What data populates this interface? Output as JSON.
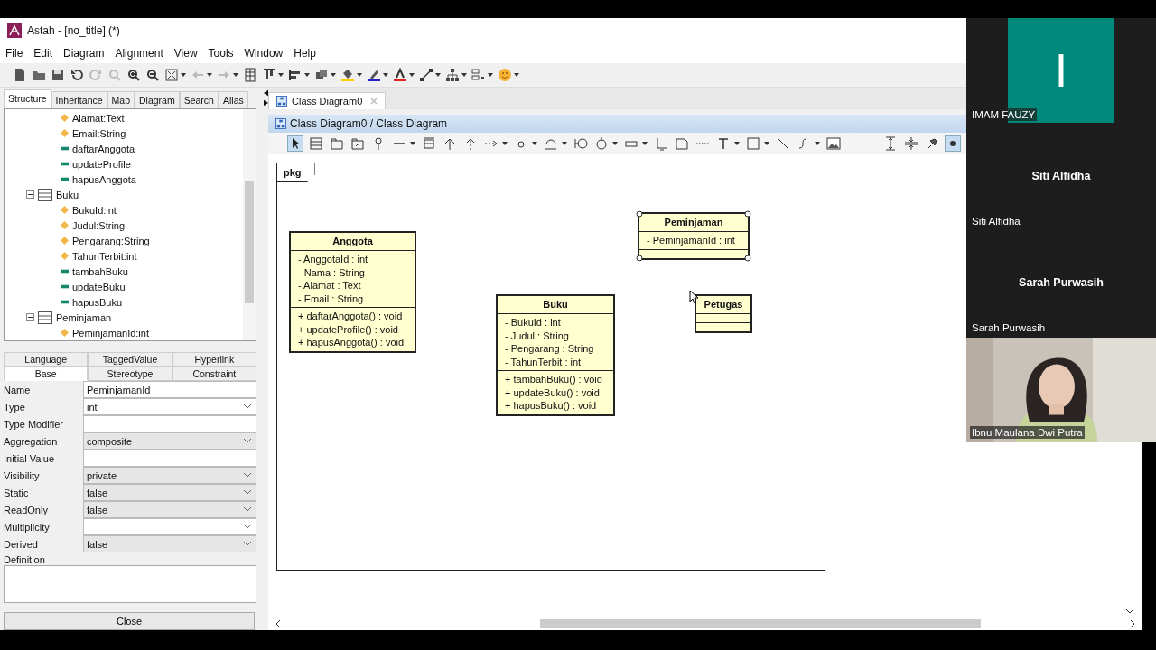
{
  "window": {
    "title": "Astah - [no_title] (*)"
  },
  "menu": [
    "File",
    "Edit",
    "Diagram",
    "Alignment",
    "View",
    "Tools",
    "Window",
    "Help"
  ],
  "left_tabs": [
    {
      "label": "Structure",
      "selected": true
    },
    {
      "label": "Inheritance",
      "selected": false
    },
    {
      "label": "Map",
      "selected": false
    },
    {
      "label": "Diagram",
      "selected": false
    },
    {
      "label": "Search",
      "selected": false
    },
    {
      "label": "Alias",
      "selected": false
    }
  ],
  "tree": [
    {
      "label": "Alamat:Text",
      "kind": "attribute"
    },
    {
      "label": "Email:String",
      "kind": "attribute"
    },
    {
      "label": "daftarAnggota",
      "kind": "operation"
    },
    {
      "label": "updateProfile",
      "kind": "operation"
    },
    {
      "label": "hapusAnggota",
      "kind": "operation"
    },
    {
      "label": "Buku",
      "kind": "class",
      "expanded": true,
      "children": [
        {
          "label": "BukuId:int",
          "kind": "attribute"
        },
        {
          "label": "Judul:String",
          "kind": "attribute"
        },
        {
          "label": "Pengarang:String",
          "kind": "attribute"
        },
        {
          "label": "TahunTerbit:int",
          "kind": "attribute"
        },
        {
          "label": "tambahBuku",
          "kind": "operation"
        },
        {
          "label": "updateBuku",
          "kind": "operation"
        },
        {
          "label": "hapusBuku",
          "kind": "operation"
        }
      ]
    },
    {
      "label": "Peminjaman",
      "kind": "class",
      "expanded": true,
      "children": [
        {
          "label": "PeminjamanId:int",
          "kind": "attribute"
        }
      ]
    }
  ],
  "property_tabs": {
    "back_row": [
      {
        "label": "Language",
        "selected": false
      },
      {
        "label": "TaggedValue",
        "selected": false
      },
      {
        "label": "Hyperlink",
        "selected": false
      }
    ],
    "front_row": [
      {
        "label": "Base",
        "selected": true
      },
      {
        "label": "Stereotype",
        "selected": false
      },
      {
        "label": "Constraint",
        "selected": false
      }
    ]
  },
  "properties": [
    {
      "label": "Name",
      "value": "PeminjamanId",
      "kind": "text"
    },
    {
      "label": "Type",
      "value": "int",
      "kind": "combo"
    },
    {
      "label": "Type Modifier",
      "kind": "text"
    },
    {
      "label": "Aggregation",
      "value": "composite",
      "kind": "select"
    },
    {
      "label": "Initial Value",
      "kind": "text"
    },
    {
      "label": "Visibility",
      "value": "private",
      "kind": "select"
    },
    {
      "label": "Static",
      "value": "false",
      "kind": "select"
    },
    {
      "label": "ReadOnly",
      "value": "false",
      "kind": "select"
    },
    {
      "label": "Multiplicity",
      "kind": "combo"
    },
    {
      "label": "Derived",
      "value": "false",
      "kind": "select"
    }
  ],
  "definition": {
    "label": "Definition"
  },
  "close_button": "Close",
  "document_tab": {
    "label": "Class Diagram0"
  },
  "diagram_title": "Class Diagram0 / Class Diagram",
  "frame_label": "pkg",
  "classes": [
    {
      "name": "Anggota",
      "selected": false,
      "attributes": [
        "- AnggotaId : int",
        "- Nama : String",
        "- Alamat : Text",
        "- Email : String"
      ],
      "operations": [
        "+ daftarAnggota() : void",
        "+ updateProfile() : void",
        "+ hapusAnggota() : void"
      ]
    },
    {
      "name": "Buku",
      "selected": false,
      "attributes": [
        "- BukuId : int",
        "- Judul : String",
        "- Pengarang : String",
        "- TahunTerbit : int"
      ],
      "operations": [
        "+ tambahBuku() : void",
        "+ updateBuku() : void",
        "+ hapusBuku() : void"
      ]
    },
    {
      "name": "Peminjaman",
      "selected": true,
      "attributes": [
        "- PeminjamanId : int"
      ]
    },
    {
      "name": "Petugas",
      "selected": false
    }
  ],
  "participants": [
    {
      "name": "IMAM FAUZY",
      "kind": "avatar",
      "initial": "I"
    },
    {
      "name": "Siti Alfidha",
      "kind": "name-only",
      "display_name": "Siti Alfidha"
    },
    {
      "name": "Sarah Purwasih",
      "kind": "name-only",
      "display_name": "Sarah Purwasih"
    },
    {
      "name": "Ibnu Maulana Dwi Putra",
      "kind": "video"
    }
  ]
}
